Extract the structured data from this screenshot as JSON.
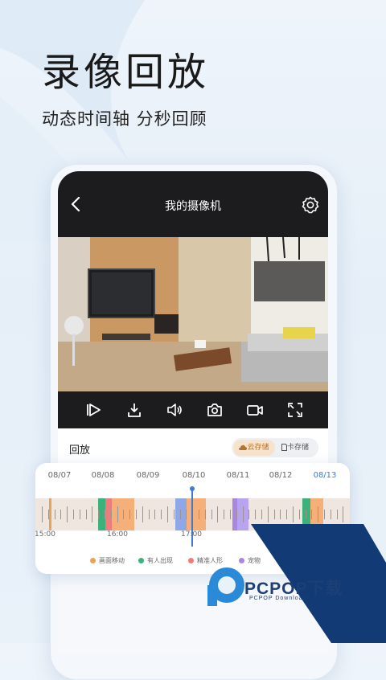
{
  "headline": "录像回放",
  "subline": "动态时间轴 分秒回顾",
  "app": {
    "title": "我的摄像机",
    "section_label": "回放",
    "storage_options": [
      {
        "label": "云存储",
        "selected": true
      },
      {
        "label": "卡存储",
        "selected": false
      }
    ]
  },
  "icons": [
    "back-arrow-icon",
    "gear-icon",
    "play-step-icon",
    "download-icon",
    "volume-icon",
    "camera-icon",
    "video-record-icon",
    "fullscreen-icon",
    "cloud-icon",
    "sd-card-icon"
  ],
  "timeline": {
    "dates": [
      "08/07",
      "08/08",
      "08/09",
      "08/10",
      "08/11",
      "08/12",
      "08/13"
    ],
    "active_date": "08/13",
    "times": [
      "15:00",
      "16:00",
      "17:00"
    ],
    "legend": [
      {
        "label": "画面移动",
        "color": "#e8a25a"
      },
      {
        "label": "有人出现",
        "color": "#3ab27a"
      },
      {
        "label": "精准人形",
        "color": "#ef7c7c"
      },
      {
        "label": "宠物",
        "color": "#a987e0"
      }
    ]
  },
  "watermark": {
    "brand": "PCPOP下载",
    "sub": "PCPOP Download"
  }
}
